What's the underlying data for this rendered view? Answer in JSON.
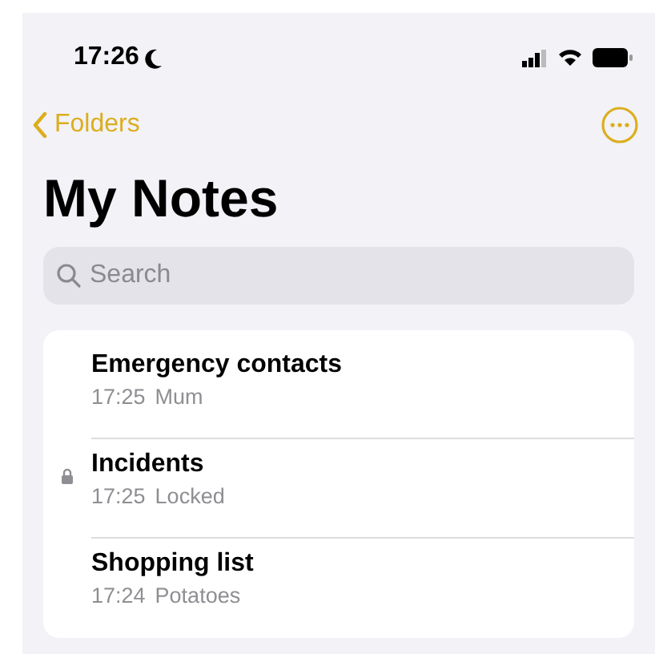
{
  "status_bar": {
    "time": "17:26"
  },
  "nav": {
    "back": "Folders"
  },
  "title": "My Notes",
  "search": {
    "placeholder": "Search"
  },
  "notes": [
    {
      "title": "Emergency contacts",
      "time": "17:25",
      "preview": "Mum",
      "locked": false
    },
    {
      "title": "Incidents",
      "time": "17:25",
      "preview": "Locked",
      "locked": true
    },
    {
      "title": "Shopping list",
      "time": "17:24",
      "preview": "Potatoes",
      "locked": false
    }
  ]
}
